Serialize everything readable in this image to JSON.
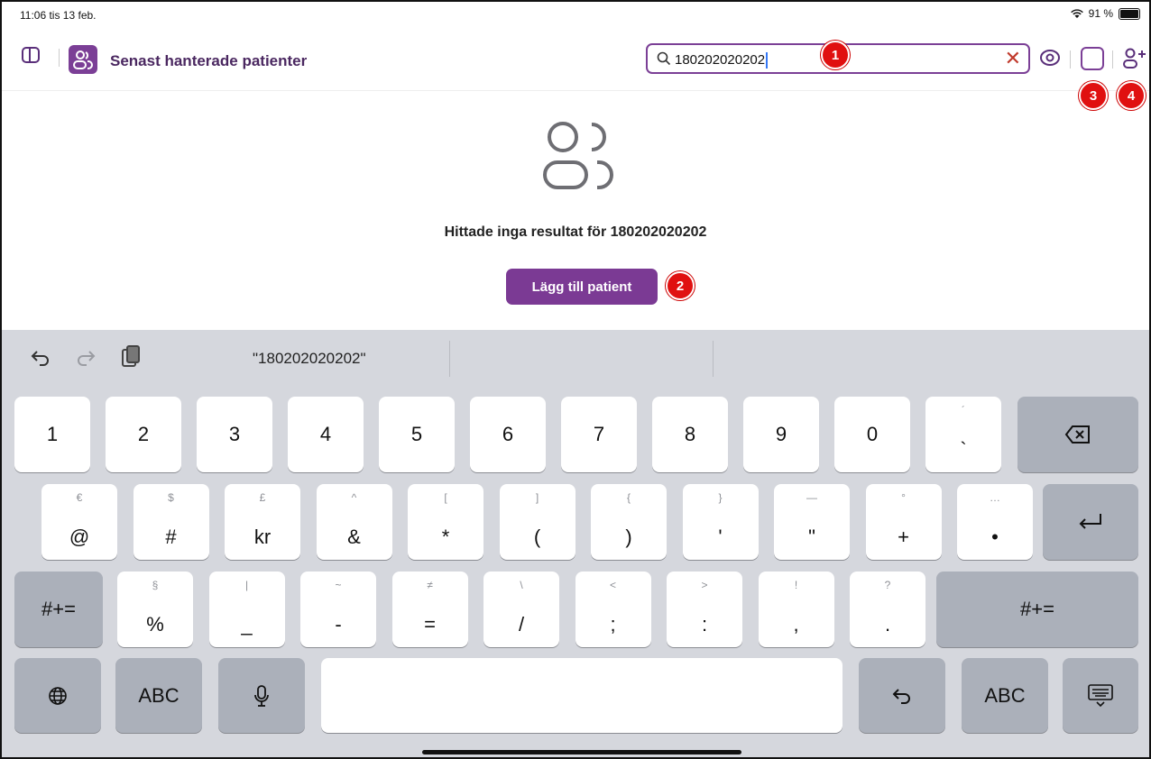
{
  "status_bar": {
    "time_date": "11:06  tis 13 feb.",
    "battery": "91 %",
    "battery_level": 0.91
  },
  "header": {
    "title": "Senast hanterade patienter"
  },
  "search": {
    "value": "180202020202"
  },
  "annotations": {
    "badge_1": "1",
    "badge_2": "2",
    "badge_3": "3",
    "badge_4": "4"
  },
  "main": {
    "message": "Hittade inga resultat för 180202020202",
    "add_button": "Lägg till patient"
  },
  "keyboard": {
    "suggestion": "\"180202020202\"",
    "row1": [
      "1",
      "2",
      "3",
      "4",
      "5",
      "6",
      "7",
      "8",
      "9",
      "0"
    ],
    "row1_grave": {
      "top": "´",
      "main": "`"
    },
    "row2": [
      {
        "top": "€",
        "main": "@"
      },
      {
        "top": "$",
        "main": "#"
      },
      {
        "top": "£",
        "main": "kr"
      },
      {
        "top": "^",
        "main": "&"
      },
      {
        "top": "[",
        "main": "*"
      },
      {
        "top": "]",
        "main": "("
      },
      {
        "top": "{",
        "main": ")"
      },
      {
        "top": "}",
        "main": "'"
      },
      {
        "top": "—",
        "main": "\""
      },
      {
        "top": "°",
        "main": "+"
      },
      {
        "top": "…",
        "main": "•"
      }
    ],
    "row3": [
      {
        "top": "§",
        "main": "%"
      },
      {
        "top": "|",
        "main": "_"
      },
      {
        "top": "~",
        "main": "-"
      },
      {
        "top": "≠",
        "main": "="
      },
      {
        "top": "\\",
        "main": "/"
      },
      {
        "top": "<",
        "main": ";"
      },
      {
        "top": ">",
        "main": ":"
      },
      {
        "top": "!",
        "main": ","
      },
      {
        "top": "?",
        "main": "."
      }
    ],
    "symbols_key": "#+=",
    "abc_key": "ABC"
  },
  "colors": {
    "accent": "#7b3f96",
    "badge": "#e01010",
    "keyboard_bg": "#d5d7dd"
  }
}
